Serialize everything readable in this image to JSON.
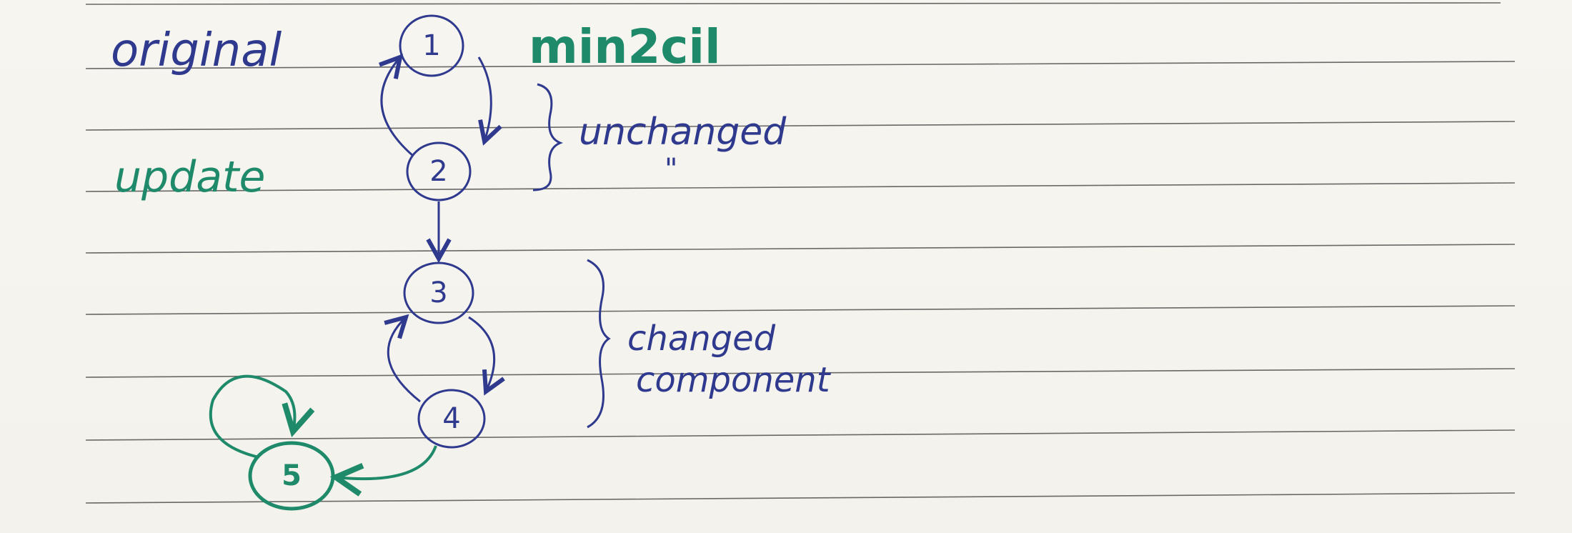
{
  "labels": {
    "original": "original",
    "update": "update",
    "min2cil": "min2cil",
    "unchanged": "unchanged",
    "ditto": "\"",
    "changed": "changed",
    "component": "component"
  },
  "nodes": [
    {
      "id": "1",
      "label": "1",
      "color": "blue"
    },
    {
      "id": "2",
      "label": "2",
      "color": "blue"
    },
    {
      "id": "3",
      "label": "3",
      "color": "blue"
    },
    {
      "id": "4",
      "label": "4",
      "color": "blue"
    },
    {
      "id": "5",
      "label": "5",
      "color": "green"
    }
  ],
  "edges": [
    {
      "from": "1",
      "to": "2",
      "color": "blue"
    },
    {
      "from": "2",
      "to": "1",
      "color": "blue"
    },
    {
      "from": "2",
      "to": "3",
      "color": "blue"
    },
    {
      "from": "3",
      "to": "4",
      "color": "blue"
    },
    {
      "from": "4",
      "to": "3",
      "color": "blue"
    },
    {
      "from": "4",
      "to": "5",
      "color": "green"
    },
    {
      "from": "5",
      "to": "5",
      "color": "green"
    }
  ],
  "colors": {
    "blue_ink": "#2f3a8f",
    "green_ink": "#1e8a6a",
    "rule_line": "#3a3a3a"
  }
}
